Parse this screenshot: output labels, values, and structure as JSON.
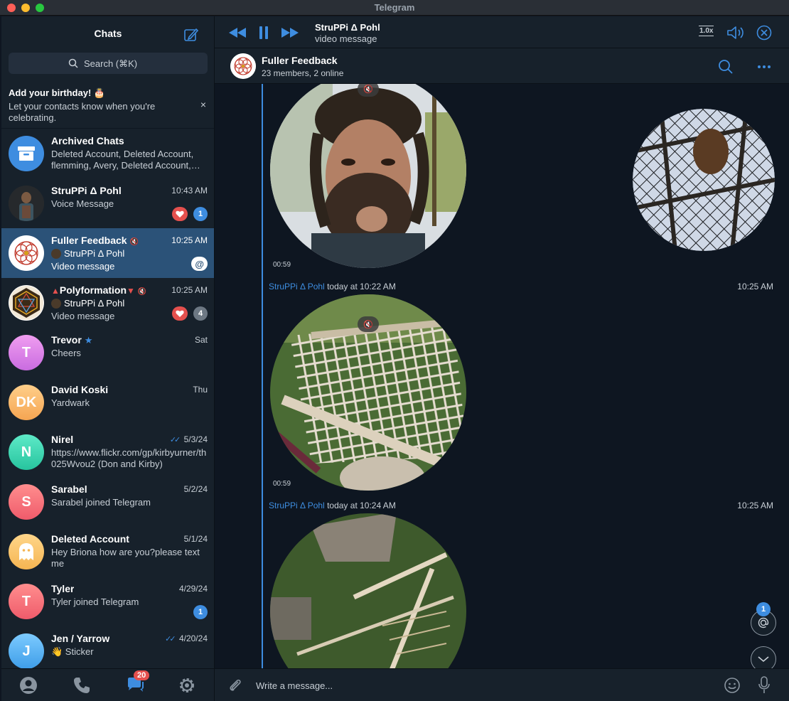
{
  "window": {
    "title": "Telegram"
  },
  "sidebar": {
    "title": "Chats",
    "search_placeholder": "Search (⌘K)",
    "birthday": {
      "title": "Add your birthday! 🎂",
      "text": "Let your contacts know when you're celebrating.",
      "close": "×"
    },
    "chats": [
      {
        "name": "Archived Chats",
        "time": "",
        "preview": "Deleted Account, Deleted Account, flemming, Avery, Deleted Account,…",
        "avatar_color": "#3e8de0"
      },
      {
        "name": "StruPPi Δ Pohl",
        "time": "10:43 AM",
        "preview": "Voice Message",
        "unread": "1"
      },
      {
        "name": "Fuller Feedback",
        "time": "10:25 AM",
        "sender": "StruPPi Δ Pohl",
        "preview": "Video message",
        "mention": "@"
      },
      {
        "name": "Polyformation",
        "time": "10:25 AM",
        "sender": "StruPPi Δ Pohl",
        "preview": "Video message",
        "unread": "4"
      },
      {
        "name": "Trevor",
        "time": "Sat",
        "preview": "Cheers",
        "initials": "T",
        "avatar_color": "#e17be0"
      },
      {
        "name": "David Koski",
        "time": "Thu",
        "preview": "Yardwark",
        "initials": "DK",
        "avatar_color": "#f5b86b"
      },
      {
        "name": "Nirel",
        "time": "5/3/24",
        "preview": "https://www.flickr.com/gp/kirbyurner/th025Wvou2 (Don and Kirby)",
        "initials": "N",
        "avatar_color": "#3fd6b4"
      },
      {
        "name": "Sarabel",
        "time": "5/2/24",
        "preview": "Sarabel joined Telegram",
        "initials": "S",
        "avatar_color": "#f27070"
      },
      {
        "name": "Deleted Account",
        "time": "5/1/24",
        "preview": "Hey Briona how are you?please text me",
        "avatar_color": "#f5c46b"
      },
      {
        "name": "Tyler",
        "time": "4/29/24",
        "preview": "Tyler joined Telegram",
        "initials": "T",
        "avatar_color": "#f27070",
        "unread": "1"
      },
      {
        "name": "Jen / Yarrow",
        "time": "4/20/24",
        "preview": "👋 Sticker",
        "initials": "J",
        "avatar_color": "#5cb8f5"
      }
    ],
    "nav_badge": "20"
  },
  "player": {
    "title": "StruPPi Δ Pohl",
    "subtitle": "video message",
    "speed": "1.0x"
  },
  "chat": {
    "name": "Fuller Feedback",
    "subtitle": "23 members, 2 online",
    "messages": [
      {
        "duration": "00:59"
      },
      {
        "sender": "StruPPi Δ Pohl",
        "meta": "today at 10:22 AM",
        "time": "10:25 AM",
        "duration": "00:59"
      },
      {
        "sender": "StruPPi Δ Pohl",
        "meta": "today at 10:24 AM",
        "time": "10:25 AM"
      }
    ],
    "mention_badge": "1",
    "composer_placeholder": "Write a message..."
  },
  "colors": {
    "accent": "#3e8de0",
    "active_chat": "#2b5278",
    "sidebar_bg": "#17212b",
    "chat_bg": "#0e1621"
  }
}
